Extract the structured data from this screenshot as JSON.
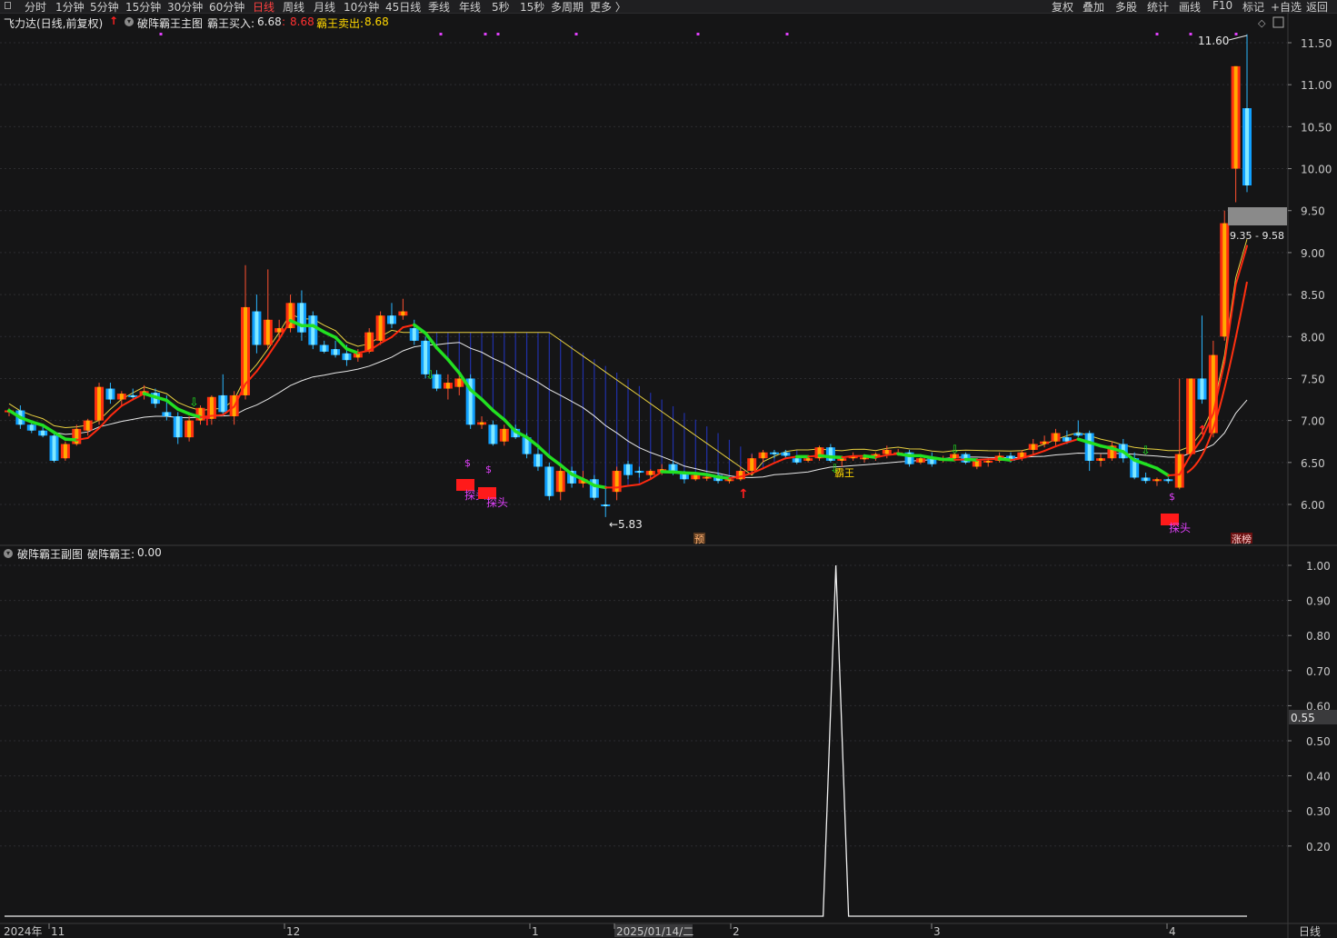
{
  "toolbar": {
    "items": [
      "分时",
      "1分钟",
      "5分钟",
      "15分钟",
      "30分钟",
      "60分钟",
      "日线",
      "周线",
      "月线",
      "10分钟",
      "45日线",
      "季线",
      "年线",
      "5秒",
      "15秒",
      "多周期",
      "更多 〉"
    ],
    "active": "日线",
    "right_items": [
      "复权",
      "叠加",
      "多股",
      "统计",
      "画线",
      "F10",
      "标记",
      "+自选",
      "返回"
    ]
  },
  "main_header": {
    "stock": "飞力达(日线,前复权)",
    "indicator": "破阵霸王主图",
    "buy_label": "霸王买入:",
    "buy_value": "6.68",
    "sep_value": "8.68",
    "sell_label": "霸王卖出:",
    "sell_value": "8.68"
  },
  "sub_header": {
    "indicator": "破阵霸王副图",
    "label": "破阵霸王:",
    "value": "0.00"
  },
  "main_axis": {
    "ticks": [
      "11.50",
      "11.00",
      "10.50",
      "10.00",
      "9.50",
      "9.00",
      "8.50",
      "8.00",
      "7.50",
      "7.00",
      "6.50",
      "6.00"
    ],
    "ymin": 5.55,
    "ymax": 11.85
  },
  "sub_axis": {
    "ticks": [
      "1.00",
      "0.90",
      "0.80",
      "0.70",
      "0.60",
      "0.50",
      "0.40",
      "0.30",
      "0.20"
    ],
    "current": "0.55"
  },
  "annotations": {
    "high_label": "11.60",
    "low_label": "←5.83",
    "range_label": "9.35 - 9.58",
    "tag_yu": "预",
    "tag_limit": "涨榜",
    "tantou": "探头",
    "dollar": "$",
    "bawang": "霸王"
  },
  "x_axis": {
    "labels": [
      "2024年",
      "11",
      "12",
      "1",
      "2025/01/14/二",
      "2",
      "3",
      "4"
    ],
    "period": "日线"
  },
  "colors": {
    "up": "#ff3a1a",
    "down": "#1ec8ff",
    "green": "#22e022",
    "ma_white": "#e8e8e8",
    "yellow": "#ffd700",
    "magenta": "#e040fb"
  },
  "chart_data": [
    {
      "type": "candlestick",
      "title": "破阵霸王主图",
      "ylim": [
        5.55,
        11.85
      ],
      "candles": [
        [
          7.1,
          7.15,
          7.05,
          7.12
        ],
        [
          7.12,
          7.18,
          6.9,
          6.95
        ],
        [
          6.95,
          6.98,
          6.85,
          6.88
        ],
        [
          6.88,
          6.95,
          6.8,
          6.82
        ],
        [
          6.82,
          6.85,
          6.5,
          6.52
        ],
        [
          6.55,
          6.75,
          6.52,
          6.72
        ],
        [
          6.72,
          6.95,
          6.7,
          6.9
        ],
        [
          6.88,
          7.02,
          6.82,
          7.0
        ],
        [
          7.0,
          7.45,
          6.95,
          7.4
        ],
        [
          7.38,
          7.45,
          7.2,
          7.25
        ],
        [
          7.25,
          7.35,
          7.18,
          7.32
        ],
        [
          7.3,
          7.38,
          7.24,
          7.28
        ],
        [
          7.3,
          7.42,
          7.25,
          7.35
        ],
        [
          7.33,
          7.38,
          7.15,
          7.2
        ],
        [
          7.1,
          7.3,
          7.0,
          7.05
        ],
        [
          7.05,
          7.1,
          6.72,
          6.8
        ],
        [
          6.8,
          7.05,
          6.75,
          7.0
        ],
        [
          7.0,
          7.18,
          6.95,
          7.15
        ],
        [
          7.02,
          7.3,
          6.95,
          7.28
        ],
        [
          7.3,
          7.55,
          7.05,
          7.1
        ],
        [
          7.05,
          7.35,
          6.95,
          7.3
        ],
        [
          7.3,
          8.85,
          7.25,
          8.35
        ],
        [
          8.3,
          8.5,
          7.8,
          7.9
        ],
        [
          7.9,
          8.8,
          7.85,
          8.2
        ],
        [
          8.05,
          8.2,
          7.95,
          8.1
        ],
        [
          8.1,
          8.5,
          8.05,
          8.4
        ],
        [
          8.4,
          8.55,
          7.95,
          8.05
        ],
        [
          8.25,
          8.3,
          7.85,
          7.9
        ],
        [
          7.9,
          7.95,
          7.8,
          7.82
        ],
        [
          7.85,
          7.95,
          7.75,
          7.78
        ],
        [
          7.8,
          7.9,
          7.65,
          7.72
        ],
        [
          7.75,
          7.85,
          7.7,
          7.8
        ],
        [
          7.82,
          8.1,
          7.8,
          8.05
        ],
        [
          7.95,
          8.3,
          7.9,
          8.25
        ],
        [
          8.25,
          8.4,
          8.1,
          8.15
        ],
        [
          8.25,
          8.45,
          8.2,
          8.3
        ],
        [
          8.1,
          8.2,
          7.9,
          7.95
        ],
        [
          7.95,
          8.0,
          7.5,
          7.55
        ],
        [
          7.55,
          7.6,
          7.35,
          7.38
        ],
        [
          7.38,
          7.55,
          7.25,
          7.45
        ],
        [
          7.4,
          7.55,
          7.3,
          7.5
        ],
        [
          7.5,
          7.55,
          6.9,
          6.95
        ],
        [
          6.95,
          7.05,
          6.9,
          6.98
        ],
        [
          6.95,
          7.0,
          6.7,
          6.72
        ],
        [
          6.75,
          6.95,
          6.7,
          6.9
        ],
        [
          6.9,
          6.95,
          6.78,
          6.8
        ],
        [
          6.8,
          6.85,
          6.55,
          6.6
        ],
        [
          6.6,
          6.7,
          6.4,
          6.45
        ],
        [
          6.45,
          6.5,
          6.05,
          6.1
        ],
        [
          6.15,
          6.45,
          6.05,
          6.4
        ],
        [
          6.4,
          6.45,
          6.2,
          6.25
        ],
        [
          6.25,
          6.4,
          6.2,
          6.3
        ],
        [
          6.3,
          6.35,
          6.05,
          6.08
        ],
        [
          6.0,
          6.2,
          5.85,
          5.98
        ],
        [
          6.15,
          6.45,
          6.05,
          6.4
        ],
        [
          6.48,
          6.52,
          6.3,
          6.35
        ],
        [
          6.4,
          6.45,
          6.32,
          6.38
        ],
        [
          6.35,
          6.42,
          6.3,
          6.4
        ],
        [
          6.38,
          6.48,
          6.35,
          6.42
        ],
        [
          6.48,
          6.52,
          6.35,
          6.38
        ],
        [
          6.38,
          6.4,
          6.25,
          6.3
        ],
        [
          6.3,
          6.38,
          6.28,
          6.35
        ],
        [
          6.32,
          6.36,
          6.28,
          6.33
        ],
        [
          6.35,
          6.38,
          6.25,
          6.28
        ],
        [
          6.28,
          6.32,
          6.25,
          6.3
        ],
        [
          6.3,
          6.45,
          6.28,
          6.4
        ],
        [
          6.4,
          6.6,
          6.38,
          6.55
        ],
        [
          6.55,
          6.65,
          6.5,
          6.62
        ],
        [
          6.62,
          6.65,
          6.55,
          6.6
        ],
        [
          6.62,
          6.65,
          6.55,
          6.58
        ],
        [
          6.55,
          6.58,
          6.48,
          6.5
        ],
        [
          6.52,
          6.58,
          6.5,
          6.55
        ],
        [
          6.55,
          6.7,
          6.52,
          6.68
        ],
        [
          6.68,
          6.72,
          6.5,
          6.52
        ],
        [
          6.52,
          6.58,
          6.45,
          6.55
        ],
        [
          6.55,
          6.62,
          6.52,
          6.58
        ],
        [
          6.55,
          6.6,
          6.5,
          6.56
        ],
        [
          6.56,
          6.62,
          6.52,
          6.6
        ],
        [
          6.6,
          6.7,
          6.55,
          6.65
        ],
        [
          6.62,
          6.66,
          6.58,
          6.62
        ],
        [
          6.62,
          6.65,
          6.45,
          6.48
        ],
        [
          6.5,
          6.58,
          6.48,
          6.55
        ],
        [
          6.55,
          6.62,
          6.45,
          6.48
        ],
        [
          6.52,
          6.58,
          6.5,
          6.55
        ],
        [
          6.55,
          6.62,
          6.52,
          6.6
        ],
        [
          6.6,
          6.62,
          6.48,
          6.5
        ],
        [
          6.45,
          6.55,
          6.42,
          6.52
        ],
        [
          6.5,
          6.55,
          6.45,
          6.52
        ],
        [
          6.52,
          6.62,
          6.5,
          6.58
        ],
        [
          6.58,
          6.62,
          6.5,
          6.52
        ],
        [
          6.55,
          6.65,
          6.52,
          6.62
        ],
        [
          6.65,
          6.78,
          6.6,
          6.72
        ],
        [
          6.72,
          6.82,
          6.68,
          6.75
        ],
        [
          6.75,
          6.9,
          6.7,
          6.85
        ],
        [
          6.8,
          6.88,
          6.72,
          6.75
        ],
        [
          6.85,
          7.0,
          6.8,
          6.82
        ],
        [
          6.85,
          6.88,
          6.4,
          6.52
        ],
        [
          6.52,
          6.6,
          6.45,
          6.55
        ],
        [
          6.55,
          6.75,
          6.52,
          6.7
        ],
        [
          6.72,
          6.78,
          6.5,
          6.55
        ],
        [
          6.55,
          6.62,
          6.3,
          6.32
        ],
        [
          6.32,
          6.38,
          6.25,
          6.28
        ],
        [
          6.28,
          6.32,
          6.22,
          6.3
        ],
        [
          6.3,
          6.32,
          6.25,
          6.28
        ],
        [
          6.2,
          7.5,
          6.18,
          6.6
        ],
        [
          6.6,
          7.5,
          6.58,
          7.5
        ],
        [
          7.5,
          8.25,
          7.2,
          7.25
        ],
        [
          6.85,
          7.95,
          6.8,
          7.78
        ],
        [
          8.0,
          9.5,
          7.95,
          9.35
        ],
        [
          10.0,
          11.2,
          9.6,
          11.22
        ],
        [
          10.72,
          11.6,
          9.72,
          9.8
        ]
      ],
      "ma_white": "slow moving average",
      "low": 5.83,
      "high": 11.6
    },
    {
      "type": "line",
      "title": "破阵霸王副图",
      "ylim": [
        0,
        1.05
      ],
      "spike_index": 75,
      "spike_value": 1.0,
      "baseline": 0
    }
  ]
}
